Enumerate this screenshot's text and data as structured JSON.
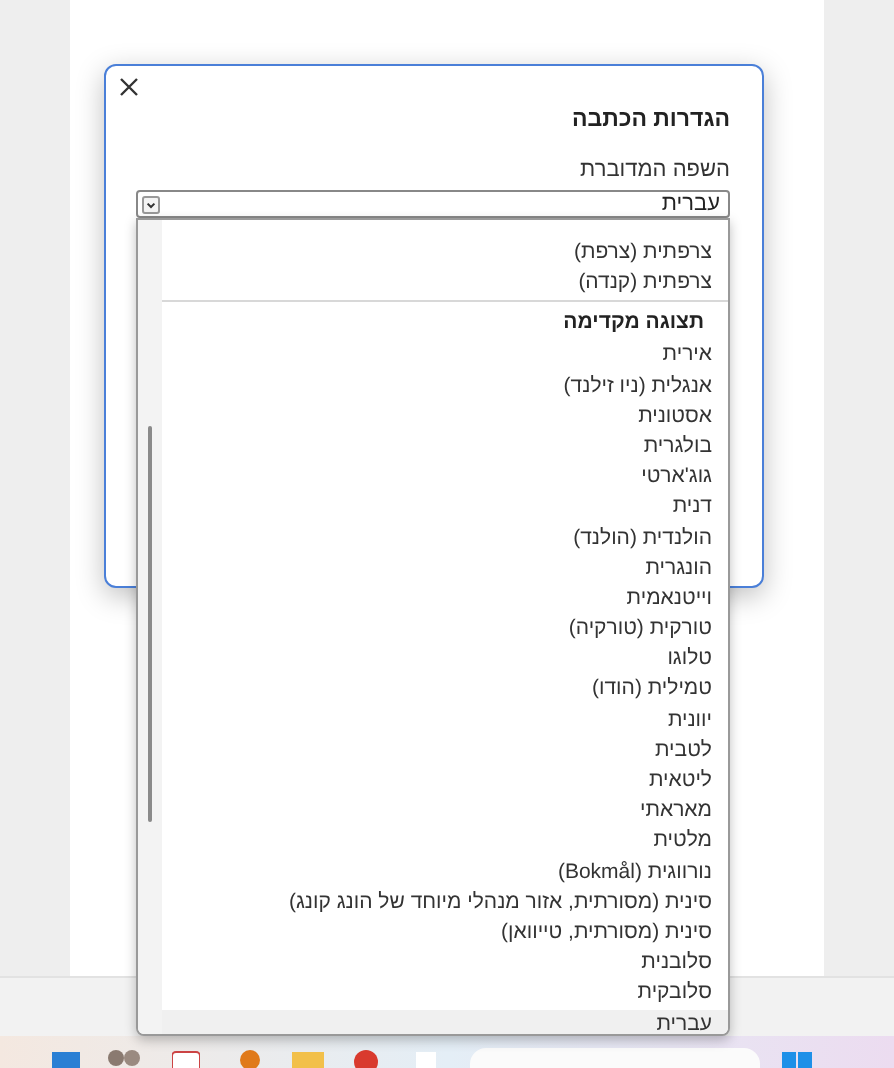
{
  "dialog": {
    "title": "הגדרות הכתבה",
    "language_label": "השפה המדוברת",
    "select": {
      "value": "עברית"
    }
  },
  "dropdown": {
    "groups": [
      {
        "items": [
          {
            "label": "צרפתית (צרפת)",
            "selected": false
          },
          {
            "label": "צרפתית (קנדה)",
            "selected": false
          }
        ]
      },
      {
        "heading": "תצוגה מקדימה",
        "items": [
          {
            "label": "אירית",
            "selected": false
          },
          {
            "label": "אנגלית (ניו זילנד)",
            "selected": false
          },
          {
            "label": "אסטונית",
            "selected": false
          },
          {
            "label": "בולגרית",
            "selected": false
          },
          {
            "label": "גוג'ארטי",
            "selected": false
          },
          {
            "label": "דנית",
            "selected": false
          },
          {
            "label": "הולנדית (הולנד)",
            "selected": false
          },
          {
            "label": "הונגרית",
            "selected": false
          },
          {
            "label": "וייטנאמית",
            "selected": false
          },
          {
            "label": "טורקית (טורקיה)",
            "selected": false
          },
          {
            "label": "טלוגו",
            "selected": false
          },
          {
            "label": "טמילית (הודו)",
            "selected": false
          },
          {
            "label": "יוונית",
            "selected": false
          },
          {
            "label": "לטבית",
            "selected": false
          },
          {
            "label": "ליטאית",
            "selected": false
          },
          {
            "label": "מאראתי",
            "selected": false
          },
          {
            "label": "מלטית",
            "selected": false
          },
          {
            "label": "נורווגית (Bokmål)",
            "selected": false
          },
          {
            "label": "סינית (מסורתית, אזור מנהלי מיוחד של הונג קונג)",
            "selected": false
          },
          {
            "label": "סינית (מסורתית, טייוואן)",
            "selected": false
          },
          {
            "label": "סלובנית",
            "selected": false
          },
          {
            "label": "סלובקית",
            "selected": false
          },
          {
            "label": "עברית",
            "selected": true
          }
        ]
      }
    ]
  }
}
